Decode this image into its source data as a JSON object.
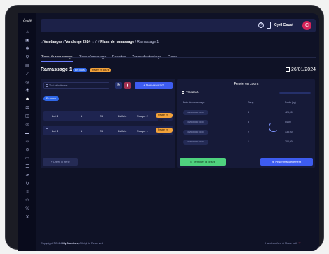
{
  "app": {
    "logo_text": "Ōnafé"
  },
  "topbar": {
    "user_name": "Cyril Goust",
    "avatar_initial": "C",
    "help_icon": "question-circle-icon",
    "phone_icon": "phone-icon"
  },
  "breadcrumb": {
    "home_icon": "home-icon",
    "item1": "Vendanges",
    "sep1": "/",
    "item2": "Vendange 2024",
    "sep2": "/",
    "item3": "Plans de ramassage",
    "sep3": "/",
    "item4": "Ramassage 1"
  },
  "tabs": [
    {
      "label": "Plans de ramassage",
      "active": true
    },
    {
      "label": "Plans d'encuvage",
      "active": false
    },
    {
      "label": "Recettes",
      "active": false
    },
    {
      "label": "Zones de stockage",
      "active": false
    },
    {
      "label": "Cuves",
      "active": false
    }
  ],
  "header": {
    "title": "Ramassage 1",
    "badge1": "En cours",
    "badge2": "Pesée en cours",
    "date": "26/01/2024"
  },
  "lots_panel": {
    "select_all_label": "Tout sélectionner",
    "new_lot_label": "+ Nouveau Lot",
    "filter_pill": "En cours",
    "rows": [
      {
        "name": "Lot 2",
        "qty": "1",
        "code": "C5",
        "type": "Défilée",
        "team": "Equipe 2",
        "status": "Pesée en cours"
      },
      {
        "name": "Lot 1",
        "qty": "1",
        "code": "C5",
        "type": "Défilée",
        "team": "Equipe 1",
        "status": "Pesée en cours"
      }
    ]
  },
  "weighing_panel": {
    "title": "Pesée en cours",
    "traitee_label": "Traitée A",
    "progress_fraction": 0,
    "columns": {
      "date": "Date de ramassage",
      "rank": "Rang",
      "kg": "Poids (kg)"
    },
    "rows": [
      {
        "date": "00/00/0000 00:00",
        "rank": "4",
        "kg": "423,00"
      },
      {
        "date": "00/00/0000 00:00",
        "rank": "3",
        "kg": "54,00"
      },
      {
        "date": "00/00/0000 00:00",
        "rank": "2",
        "kg": "133,00"
      },
      {
        "date": "00/00/0000 00:00",
        "rank": "1",
        "kg": "204,00"
      }
    ]
  },
  "actions": {
    "create_lot": "+ Créer lo serie",
    "finish": "⊙ Terminer la pesée",
    "manual": "⊕ Peser manuellement"
  },
  "footer": {
    "copyright_prefix": "Copyright ©2024 ",
    "brand": "MyBacchus",
    "copyright_suffix": ", All rights Reserved",
    "made_with": "Hand-crafted & Made with"
  },
  "colors": {
    "accent": "#3d5cf0",
    "success": "#4fd27e",
    "warning": "#f2a23a",
    "danger": "#d6245a",
    "background": "#0f1226"
  }
}
